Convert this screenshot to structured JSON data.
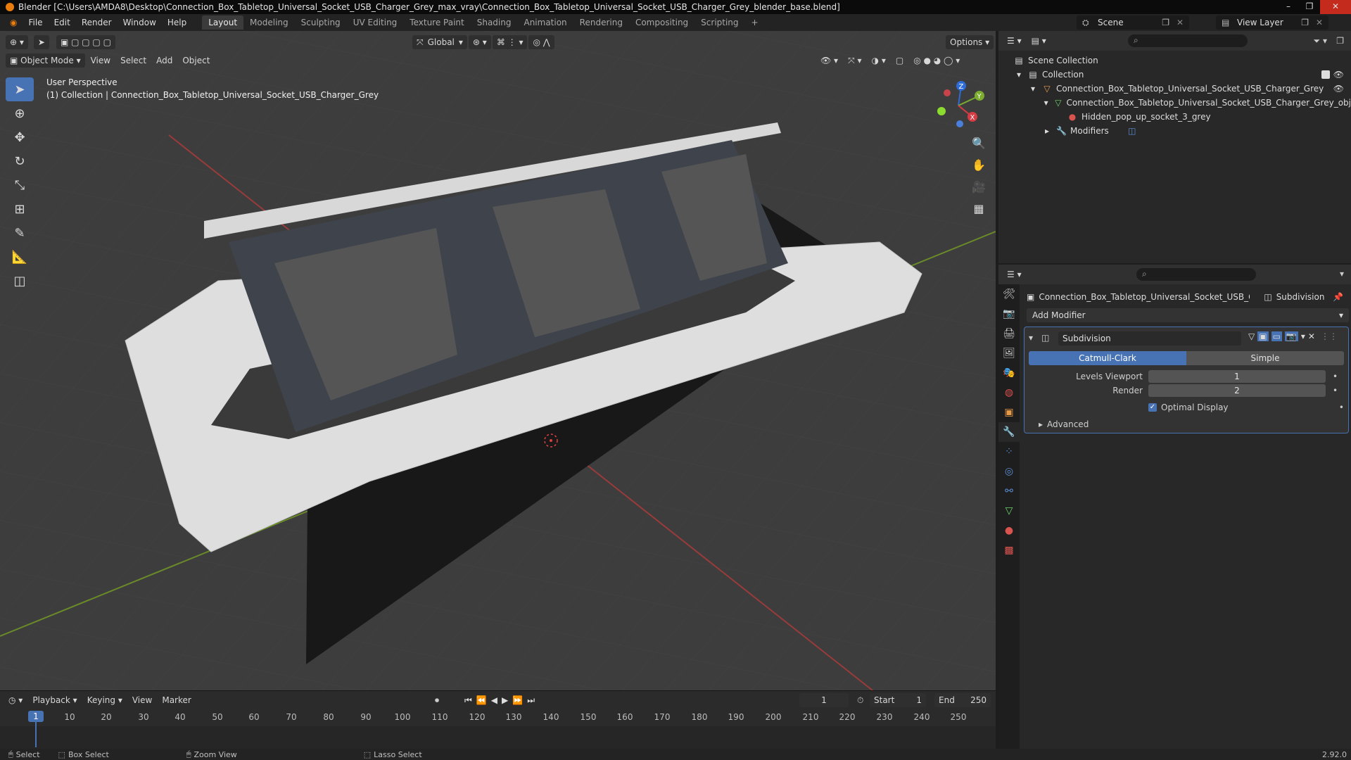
{
  "window": {
    "title": "Blender [C:\\Users\\AMDA8\\Desktop\\Connection_Box_Tabletop_Universal_Socket_USB_Charger_Grey_max_vray\\Connection_Box_Tabletop_Universal_Socket_USB_Charger_Grey_blender_base.blend]",
    "controls": [
      "–",
      "❐",
      "✕"
    ]
  },
  "menu": [
    "File",
    "Edit",
    "Render",
    "Window",
    "Help"
  ],
  "workspaces": [
    "Layout",
    "Modeling",
    "Sculpting",
    "UV Editing",
    "Texture Paint",
    "Shading",
    "Animation",
    "Rendering",
    "Compositing",
    "Scripting"
  ],
  "workspace_add": "+",
  "scene": "Scene",
  "view_layer": "View Layer",
  "viewport": {
    "transform_orientation": "Global",
    "options_label": "Options",
    "mode": "Object Mode",
    "menus": [
      "View",
      "Select",
      "Add",
      "Object"
    ],
    "perspective_label": "User Perspective",
    "collection_label": "(1) Collection | Connection_Box_Tabletop_Universal_Socket_USB_Charger_Grey",
    "gizmo_axes": [
      "Z",
      "Y",
      "X"
    ]
  },
  "timeline": {
    "menus": [
      "Playback",
      "Keying",
      "View",
      "Marker"
    ],
    "current_frame": "1",
    "start_label": "Start",
    "start": "1",
    "end_label": "End",
    "end": "250",
    "ruler": [
      "10",
      "20",
      "30",
      "40",
      "50",
      "60",
      "70",
      "80",
      "90",
      "100",
      "110",
      "120",
      "130",
      "140",
      "150",
      "160",
      "170",
      "180",
      "190",
      "200",
      "210",
      "220",
      "230",
      "240",
      "250"
    ]
  },
  "status": {
    "select": "Select",
    "box_select": "Box Select",
    "zoom_view": "Zoom View",
    "lasso_select": "Lasso Select",
    "version": "2.92.0"
  },
  "outliner": {
    "rows": [
      {
        "label": "Scene Collection"
      },
      {
        "label": "Collection"
      },
      {
        "label": "Connection_Box_Tabletop_Universal_Socket_USB_Charger_Grey"
      },
      {
        "label": "Connection_Box_Tabletop_Universal_Socket_USB_Charger_Grey_obj"
      },
      {
        "label": "Hidden_pop_up_socket_3_grey"
      },
      {
        "label": "Modifiers"
      }
    ]
  },
  "properties": {
    "object_name": "Connection_Box_Tabletop_Universal_Socket_USB_Charger...",
    "modifier_crumb": "Subdivision",
    "add_modifier": "Add Modifier",
    "modifier": {
      "name": "Subdivision",
      "algorithm_options": [
        "Catmull-Clark",
        "Simple"
      ],
      "levels_viewport_label": "Levels Viewport",
      "levels_viewport": "1",
      "render_label": "Render",
      "render": "2",
      "optimal_display_label": "Optimal Display",
      "advanced_label": "Advanced"
    }
  },
  "colors": {
    "accent": "#4772b3",
    "viewport_bg": "#3d3d3d",
    "panel_bg": "#282828"
  }
}
